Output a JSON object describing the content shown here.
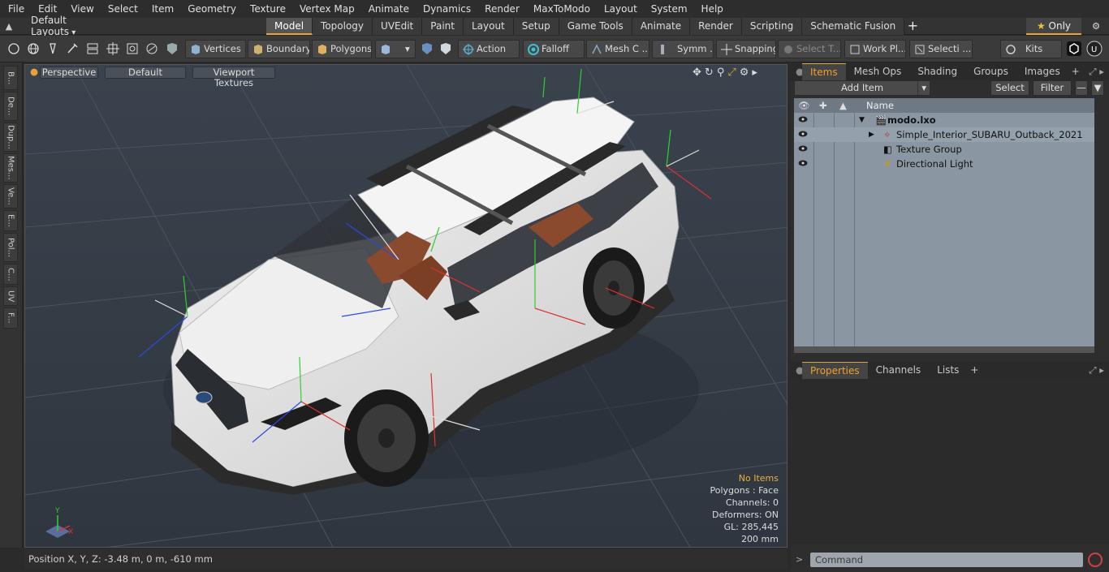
{
  "menu": [
    "File",
    "Edit",
    "View",
    "Select",
    "Item",
    "Geometry",
    "Texture",
    "Vertex Map",
    "Animate",
    "Dynamics",
    "Render",
    "MaxToModo",
    "Layout",
    "System",
    "Help"
  ],
  "layouts": {
    "label": "Default Layouts"
  },
  "mode_tabs": [
    "Model",
    "Topology",
    "UVEdit",
    "Paint",
    "Layout",
    "Setup",
    "Game Tools",
    "Animate",
    "Render",
    "Scripting",
    "Schematic Fusion"
  ],
  "only": {
    "label": "Only"
  },
  "toolbar": {
    "vertices": "Vertices",
    "boundary": "Boundary",
    "polygons": "Polygons",
    "action": "Action",
    "falloff": "Falloff",
    "mesh": "Mesh C ...",
    "symm": "Symm ...",
    "snapping": "Snapping",
    "select_t": "Select T...",
    "work_pl": "Work Pl...",
    "selecti": "Selecti ...",
    "kits": "Kits"
  },
  "left_tabs": [
    "B...",
    "De...",
    "Dup...",
    "Mes...",
    "Ve...",
    "E...",
    "Pol...",
    "C...",
    "UV",
    "F..."
  ],
  "viewport": {
    "perspective": "Perspective",
    "default": "Default",
    "textures": "Viewport Textures",
    "info": [
      "No Items",
      "Polygons : Face",
      "Channels: 0",
      "Deformers: ON",
      "GL: 285,445",
      "200 mm"
    ],
    "axis_x": "X",
    "axis_y": "Y"
  },
  "status": {
    "position": "Position X, Y, Z:   -3.48 m, 0 m, -610 mm"
  },
  "items_panel": {
    "tabs": [
      "Items",
      "Mesh Ops",
      "Shading",
      "Groups",
      "Images"
    ],
    "add_item": "Add Item",
    "select": "Select",
    "filter": "Filter",
    "name_col": "Name",
    "rows": [
      "modo.lxo",
      "Simple_Interior_SUBARU_Outback_2021",
      "Texture Group",
      "Directional Light"
    ]
  },
  "props_panel": {
    "tabs": [
      "Properties",
      "Channels",
      "Lists"
    ]
  },
  "command": {
    "placeholder": "Command"
  },
  "colors": {
    "accent": "#e8a23a",
    "viewport_bg": "#3c4450",
    "list_bg": "#8b96a3"
  }
}
